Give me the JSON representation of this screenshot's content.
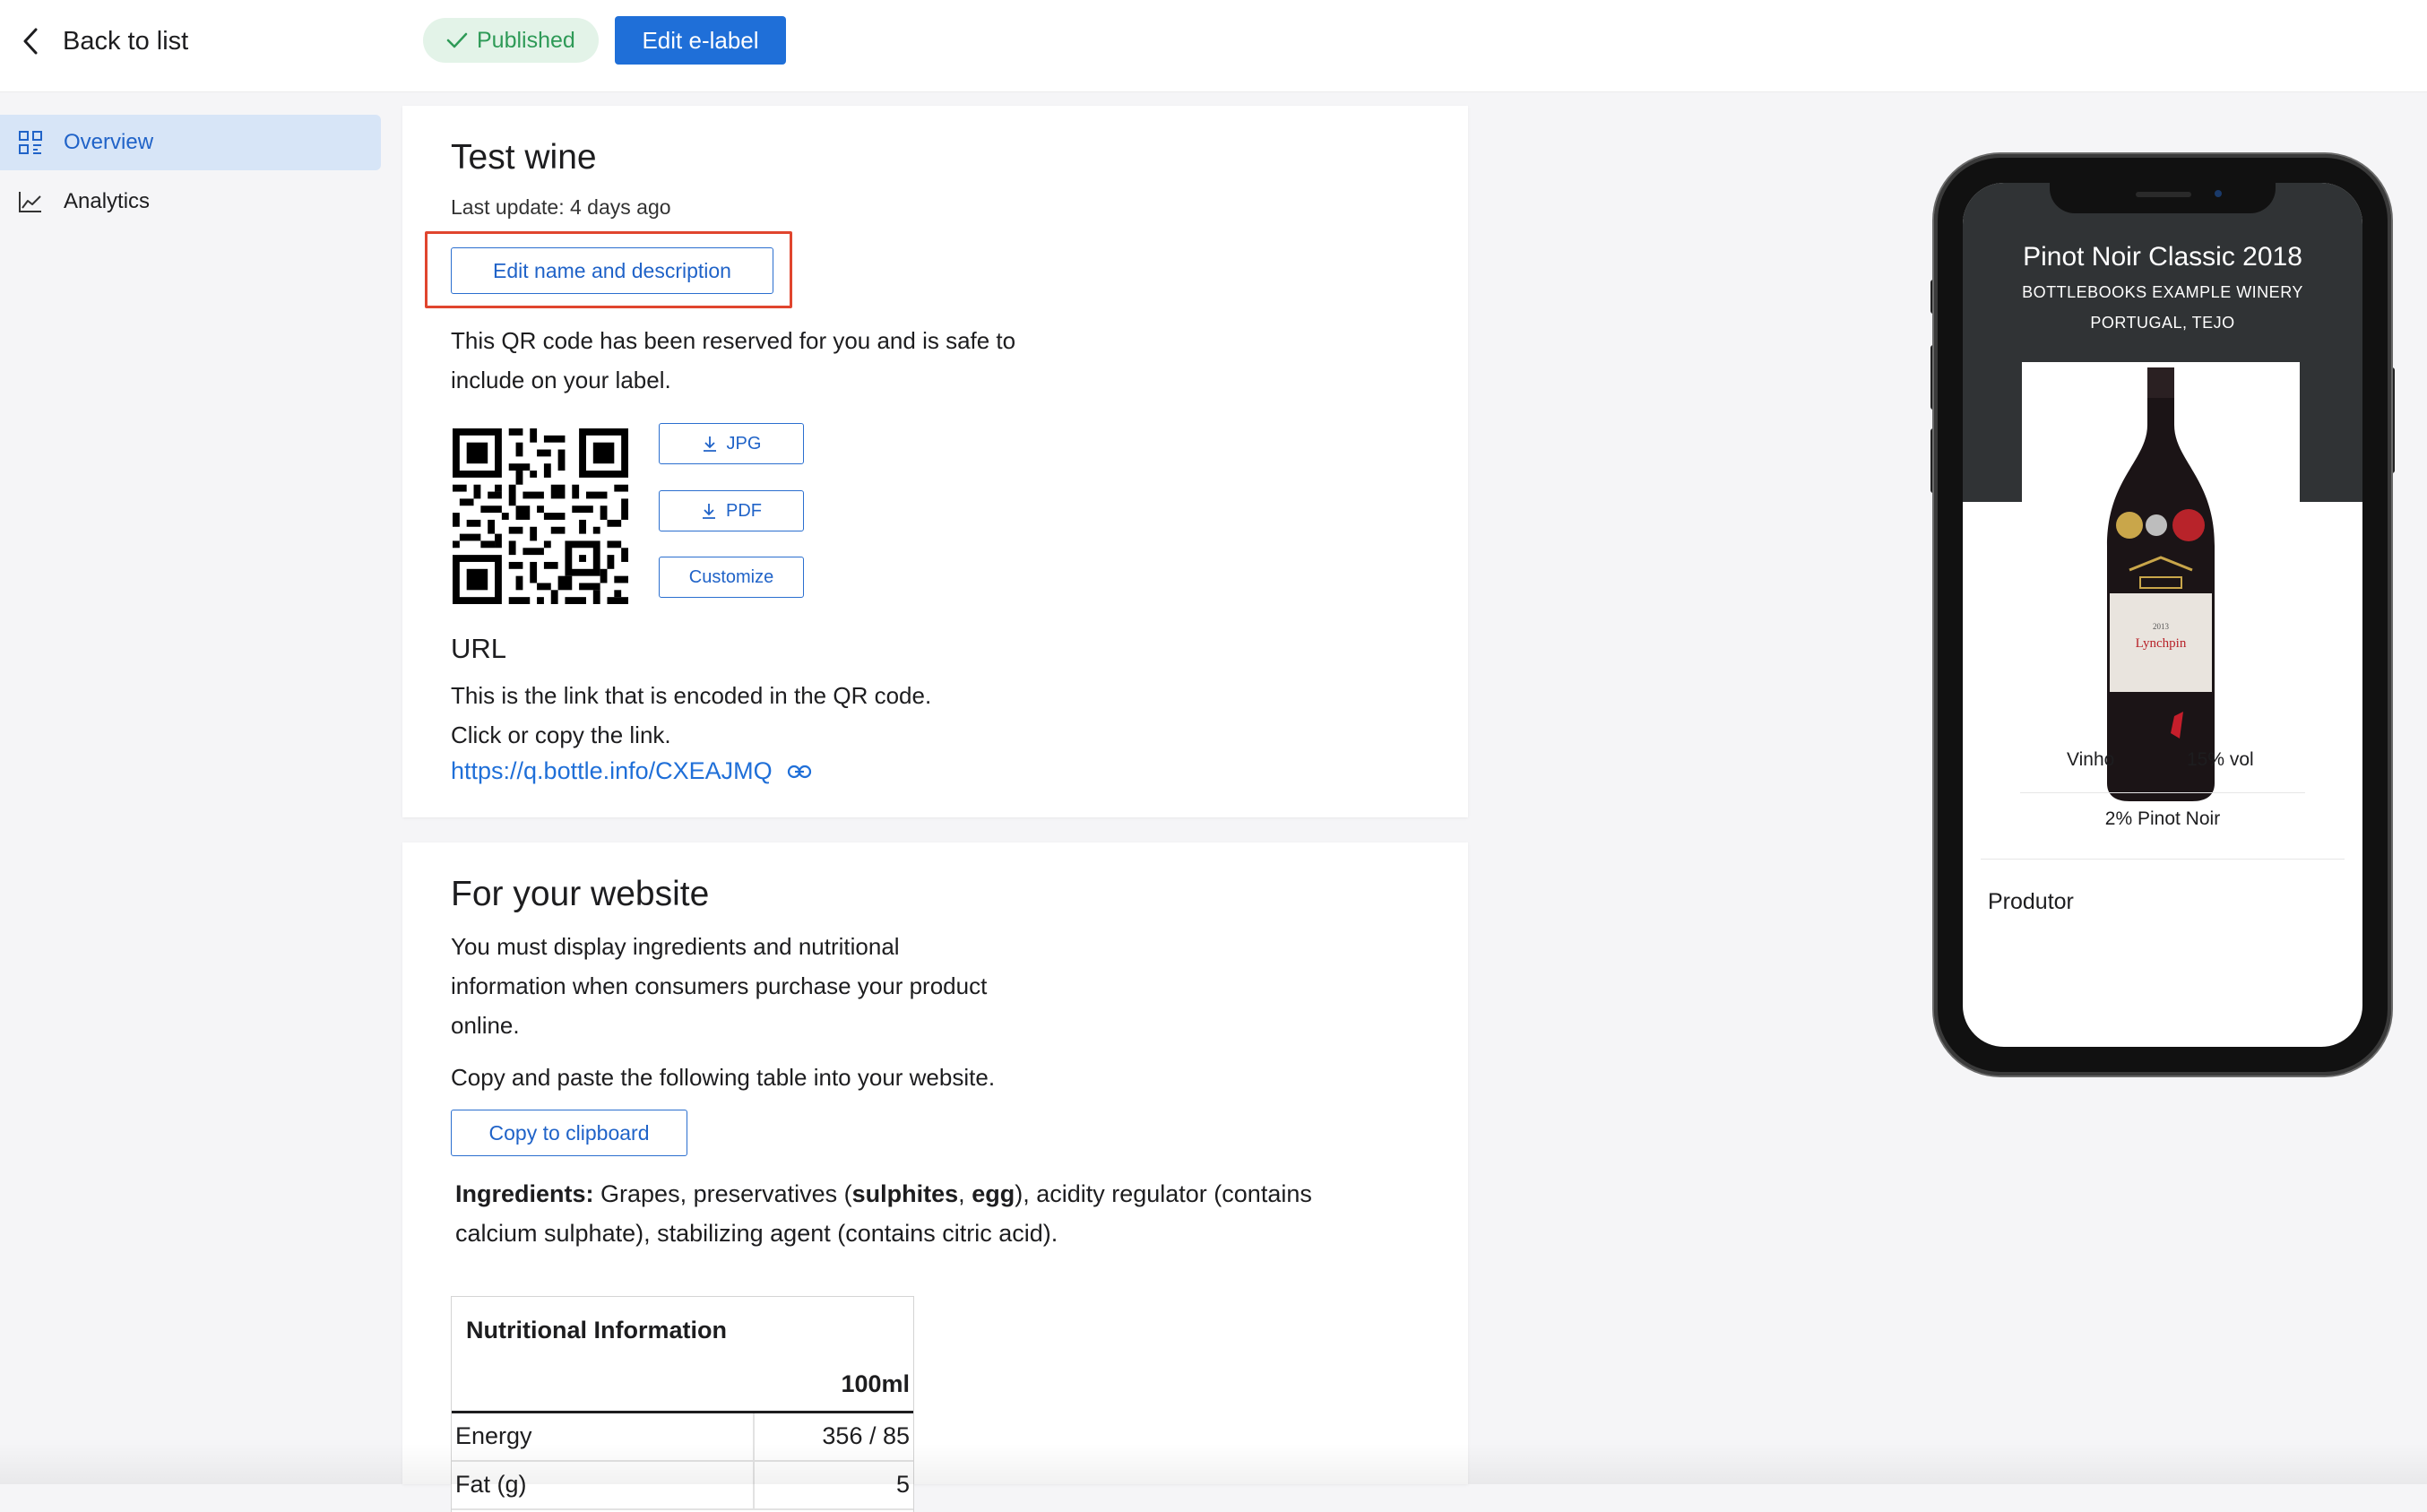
{
  "topbar": {
    "back_label": "Back to list",
    "status_badge": "Published",
    "edit_elabel_button": "Edit e-label"
  },
  "sidebar": {
    "items": [
      {
        "label": "Overview",
        "icon": "grid-icon",
        "active": true
      },
      {
        "label": "Analytics",
        "icon": "line-chart-icon",
        "active": false
      }
    ]
  },
  "product": {
    "name": "Test wine",
    "last_update": "Last update: 4 days ago",
    "edit_name_button": "Edit name and description",
    "qr_text_line1": "This QR code has been reserved for you and is safe to",
    "qr_text_line2": "include on your label.",
    "jpg_button": "JPG",
    "pdf_button": "PDF",
    "customize_button": "Customize",
    "url_heading": "URL",
    "url_text_line1": "This is the link that is encoded in the QR code.",
    "url_text_line2": "Click or copy the link.",
    "url_link": "https://q.bottle.info/CXEAJMQ"
  },
  "website": {
    "heading": "For your website",
    "text_line1": "You must display ingredients and nutritional",
    "text_line2": "information when consumers purchase your product",
    "text_line3": "online.",
    "copy_text": "Copy and paste the following table into your website.",
    "copy_button": "Copy to clipboard",
    "ingredients_label": "Ingredients:",
    "ingredients_part1": "Grapes, preservatives (",
    "ingredients_bold1": "sulphites",
    "ingredients_part2": ", ",
    "ingredients_bold2": "egg",
    "ingredients_part3": "), acidity regulator (contains",
    "ingredients_line2": "calcium sulphate), stabilizing agent (contains citric acid).",
    "nutrition": {
      "title": "Nutritional Information",
      "column": "100ml",
      "rows": [
        {
          "label": "Energy",
          "value": "356 / 85"
        },
        {
          "label": "Fat (g)",
          "value": "5"
        }
      ]
    }
  },
  "phone_preview": {
    "title": "Pinot Noir Classic 2018",
    "winery": "BOTTLEBOOKS EXAMPLE WINERY",
    "region": "PORTUGAL, TEJO",
    "type": "Vinho",
    "abv": "15% vol",
    "grape": "2% Pinot Noir",
    "section": "Produtor",
    "bottle_label": "Lynchpin",
    "bottle_year": "2013"
  },
  "colors": {
    "accent": "#1f6fd8",
    "published_bg": "#e3f3e8",
    "published_text": "#2e9a57",
    "highlight": "#e0452e"
  }
}
